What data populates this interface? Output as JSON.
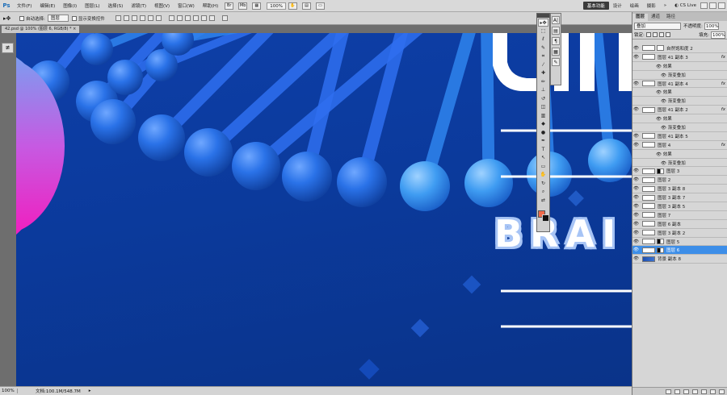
{
  "menubar": {
    "logo": "Ps",
    "items": [
      "文件(F)",
      "编辑(E)",
      "图像(I)",
      "图层(L)",
      "选择(S)",
      "滤镜(T)",
      "视图(V)",
      "窗口(W)",
      "帮助(H)"
    ],
    "zoom": "100%",
    "workspace_active": "基本功能",
    "workspaces": [
      "设计",
      "绘画",
      "摄影"
    ],
    "overflow": "»",
    "cslive": "CS Live"
  },
  "options": {
    "auto_select_label": "自动选择:",
    "auto_select_value": "图层",
    "show_transform_label": "显示变换控件"
  },
  "document": {
    "tab_title": "42.psd @ 100% (图层 6, RGB/8) *",
    "status_zoom": "100%",
    "status_doc": "文档:100.1M/548.7M"
  },
  "canvas": {
    "brai_text": "BRAI",
    "colors": {
      "bg_top": "#0e3fa8",
      "bg_bottom": "#0a3389",
      "sphere": "#2a72e8",
      "rod": "#2f6ff0"
    }
  },
  "layers_panel": {
    "tabs": [
      "图层",
      "通道",
      "路径"
    ],
    "blend_mode": "叠加",
    "opacity_label": "不透明度:",
    "opacity_value": "100%",
    "lock_label": "锁定:",
    "fill_label": "填充:",
    "fill_value": "100%",
    "layers": [
      {
        "name": "自然饱和度 2",
        "kind": "adjust",
        "fx": false,
        "selected": false
      },
      {
        "name": "图层 41 副本 3",
        "kind": "layer",
        "fx": true,
        "selected": false
      },
      {
        "name": "效果",
        "kind": "effects",
        "fx": false,
        "selected": false
      },
      {
        "name": "渐变叠加",
        "kind": "effect",
        "fx": false,
        "selected": false
      },
      {
        "name": "图层 41 副本 4",
        "kind": "layer",
        "fx": true,
        "selected": false
      },
      {
        "name": "效果",
        "kind": "effects",
        "fx": false,
        "selected": false
      },
      {
        "name": "渐变叠加",
        "kind": "effect",
        "fx": false,
        "selected": false
      },
      {
        "name": "图层 41 副本 2",
        "kind": "layer",
        "fx": true,
        "selected": false
      },
      {
        "name": "效果",
        "kind": "effects",
        "fx": false,
        "selected": false
      },
      {
        "name": "渐变叠加",
        "kind": "effect",
        "fx": false,
        "selected": false
      },
      {
        "name": "图层 41 副本 5",
        "kind": "layer",
        "fx": false,
        "selected": false
      },
      {
        "name": "图层 4",
        "kind": "layer",
        "fx": true,
        "selected": false
      },
      {
        "name": "效果",
        "kind": "effects",
        "fx": false,
        "selected": false
      },
      {
        "name": "渐变叠加",
        "kind": "effect",
        "fx": false,
        "selected": false
      },
      {
        "name": "图层 3",
        "kind": "masked",
        "fx": false,
        "selected": false
      },
      {
        "name": "图层 2",
        "kind": "layer",
        "fx": false,
        "selected": false
      },
      {
        "name": "图层 3 副本 8",
        "kind": "layer",
        "fx": false,
        "selected": false
      },
      {
        "name": "图层 3 副本 7",
        "kind": "layer",
        "fx": false,
        "selected": false
      },
      {
        "name": "图层 3 副本 5",
        "kind": "layer",
        "fx": false,
        "selected": false
      },
      {
        "name": "图层 7",
        "kind": "layer",
        "fx": false,
        "selected": false
      },
      {
        "name": "图层 6 副本",
        "kind": "layer",
        "fx": false,
        "selected": false
      },
      {
        "name": "图层 3 副本 2",
        "kind": "layer",
        "fx": false,
        "selected": false
      },
      {
        "name": "图层 5",
        "kind": "masked",
        "fx": false,
        "selected": false
      },
      {
        "name": "图层 6",
        "kind": "masked",
        "fx": false,
        "selected": true
      },
      {
        "name": "背景 副本 8",
        "kind": "blue",
        "fx": false,
        "selected": false
      }
    ]
  },
  "tools": [
    "move",
    "marquee",
    "lasso",
    "quick-select",
    "crop",
    "eyedropper",
    "healing",
    "brush",
    "clone",
    "history",
    "eraser",
    "gradient",
    "blur",
    "dodge",
    "pen",
    "type",
    "path-select",
    "shape",
    "hand",
    "rotate",
    "zoom",
    "swap"
  ]
}
